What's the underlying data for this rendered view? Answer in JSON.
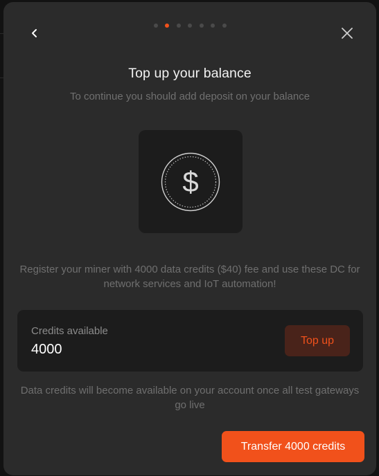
{
  "modal": {
    "title": "Top up your balance",
    "subtitle": "To continue you should add deposit on your balance",
    "description": "Register your miner with 4000 data credits ($40) fee and use these DC for network services and IoT automation!",
    "stepper": {
      "total_steps": 7,
      "active_step": 2
    },
    "icons": {
      "back": "chevron-left-icon",
      "close": "close-icon",
      "coin": "dollar-coin-icon"
    },
    "coin_symbol": "$",
    "credits": {
      "label": "Credits available",
      "value": "4000",
      "topup_label": "Top up"
    },
    "note": "Data credits will become available on your account once all test gateways go live",
    "transfer_label": "Transfer 4000 credits"
  },
  "colors": {
    "accent": "#f1511b",
    "modal_bg": "#2b2b2b",
    "card_bg": "#1c1c1c",
    "topup_bg": "#49231a"
  }
}
